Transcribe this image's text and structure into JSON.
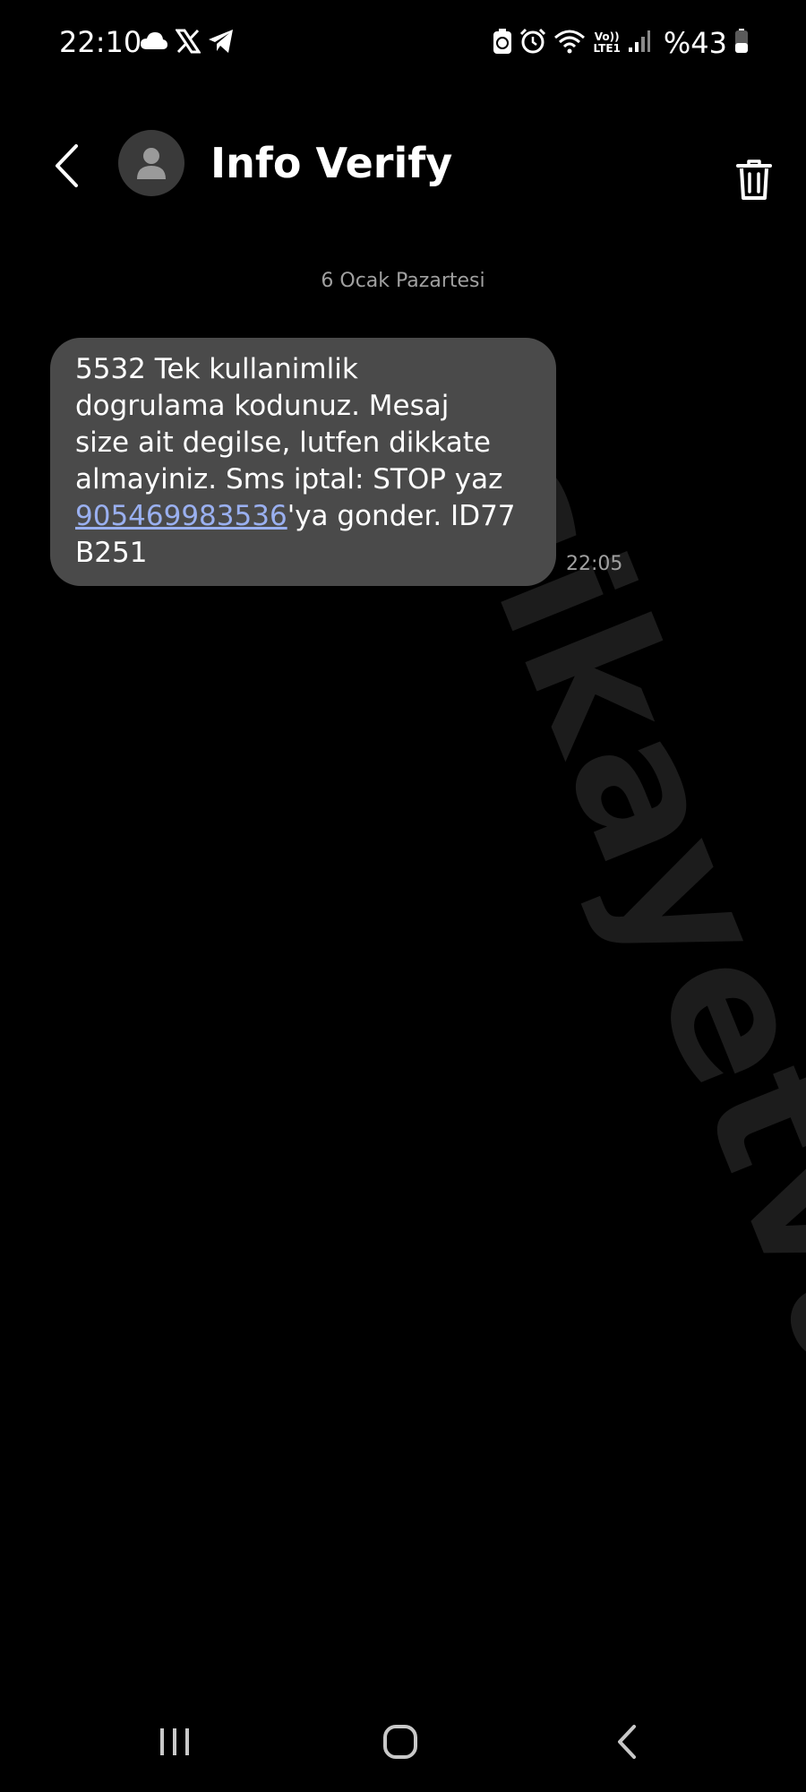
{
  "status_bar": {
    "time": "22:10",
    "left_icons": [
      "cloud-icon",
      "x-logo-icon",
      "telegram-icon"
    ],
    "right_icons": [
      "battery-saver-icon",
      "alarm-icon",
      "wifi-icon",
      "volte-icon",
      "signal-icon",
      "battery-icon"
    ],
    "volte_line1": "Vo))",
    "volte_line2": "LTE1",
    "battery_text": "%43",
    "battery_level": 0.43
  },
  "header": {
    "contact_name": "Info Verify",
    "back_icon": "chevron-left-icon",
    "avatar_icon": "person-icon",
    "delete_icon": "trash-icon"
  },
  "conversation": {
    "date_separator": "6 Ocak Pazartesi",
    "messages": [
      {
        "line1": "5532 Tek kullanimlik",
        "line2": "dogrulama kodunuz. Mesaj",
        "line3": "size ait degilse, lutfen dikkate",
        "line4": "almayiniz. Sms iptal: STOP yaz",
        "link": "905469983536",
        "after_link": "'ya gonder. ID77",
        "line6": "B251",
        "time": "22:05"
      }
    ]
  },
  "watermark": "şikayetvar",
  "nav_bar": {
    "icons": [
      "recent-apps-icon",
      "home-icon",
      "back-nav-icon"
    ]
  },
  "colors": {
    "background": "#000000",
    "bubble": "#4a4a4a",
    "link": "#9ab0f0",
    "secondary_text": "#a0a0a0",
    "avatar_bg": "#3a3a3a"
  }
}
